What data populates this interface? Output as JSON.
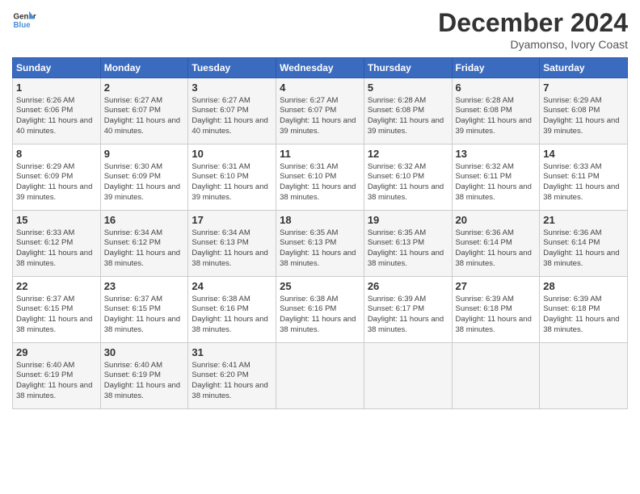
{
  "header": {
    "logo_line1": "General",
    "logo_line2": "Blue",
    "month": "December 2024",
    "location": "Dyamonso, Ivory Coast"
  },
  "weekdays": [
    "Sunday",
    "Monday",
    "Tuesday",
    "Wednesday",
    "Thursday",
    "Friday",
    "Saturday"
  ],
  "weeks": [
    [
      {
        "day": 1,
        "sunrise": "6:26 AM",
        "sunset": "6:06 PM",
        "daylight": "11 hours and 40 minutes."
      },
      {
        "day": 2,
        "sunrise": "6:27 AM",
        "sunset": "6:07 PM",
        "daylight": "11 hours and 40 minutes."
      },
      {
        "day": 3,
        "sunrise": "6:27 AM",
        "sunset": "6:07 PM",
        "daylight": "11 hours and 40 minutes."
      },
      {
        "day": 4,
        "sunrise": "6:27 AM",
        "sunset": "6:07 PM",
        "daylight": "11 hours and 39 minutes."
      },
      {
        "day": 5,
        "sunrise": "6:28 AM",
        "sunset": "6:08 PM",
        "daylight": "11 hours and 39 minutes."
      },
      {
        "day": 6,
        "sunrise": "6:28 AM",
        "sunset": "6:08 PM",
        "daylight": "11 hours and 39 minutes."
      },
      {
        "day": 7,
        "sunrise": "6:29 AM",
        "sunset": "6:08 PM",
        "daylight": "11 hours and 39 minutes."
      }
    ],
    [
      {
        "day": 8,
        "sunrise": "6:29 AM",
        "sunset": "6:09 PM",
        "daylight": "11 hours and 39 minutes."
      },
      {
        "day": 9,
        "sunrise": "6:30 AM",
        "sunset": "6:09 PM",
        "daylight": "11 hours and 39 minutes."
      },
      {
        "day": 10,
        "sunrise": "6:31 AM",
        "sunset": "6:10 PM",
        "daylight": "11 hours and 39 minutes."
      },
      {
        "day": 11,
        "sunrise": "6:31 AM",
        "sunset": "6:10 PM",
        "daylight": "11 hours and 38 minutes."
      },
      {
        "day": 12,
        "sunrise": "6:32 AM",
        "sunset": "6:10 PM",
        "daylight": "11 hours and 38 minutes."
      },
      {
        "day": 13,
        "sunrise": "6:32 AM",
        "sunset": "6:11 PM",
        "daylight": "11 hours and 38 minutes."
      },
      {
        "day": 14,
        "sunrise": "6:33 AM",
        "sunset": "6:11 PM",
        "daylight": "11 hours and 38 minutes."
      }
    ],
    [
      {
        "day": 15,
        "sunrise": "6:33 AM",
        "sunset": "6:12 PM",
        "daylight": "11 hours and 38 minutes."
      },
      {
        "day": 16,
        "sunrise": "6:34 AM",
        "sunset": "6:12 PM",
        "daylight": "11 hours and 38 minutes."
      },
      {
        "day": 17,
        "sunrise": "6:34 AM",
        "sunset": "6:13 PM",
        "daylight": "11 hours and 38 minutes."
      },
      {
        "day": 18,
        "sunrise": "6:35 AM",
        "sunset": "6:13 PM",
        "daylight": "11 hours and 38 minutes."
      },
      {
        "day": 19,
        "sunrise": "6:35 AM",
        "sunset": "6:13 PM",
        "daylight": "11 hours and 38 minutes."
      },
      {
        "day": 20,
        "sunrise": "6:36 AM",
        "sunset": "6:14 PM",
        "daylight": "11 hours and 38 minutes."
      },
      {
        "day": 21,
        "sunrise": "6:36 AM",
        "sunset": "6:14 PM",
        "daylight": "11 hours and 38 minutes."
      }
    ],
    [
      {
        "day": 22,
        "sunrise": "6:37 AM",
        "sunset": "6:15 PM",
        "daylight": "11 hours and 38 minutes."
      },
      {
        "day": 23,
        "sunrise": "6:37 AM",
        "sunset": "6:15 PM",
        "daylight": "11 hours and 38 minutes."
      },
      {
        "day": 24,
        "sunrise": "6:38 AM",
        "sunset": "6:16 PM",
        "daylight": "11 hours and 38 minutes."
      },
      {
        "day": 25,
        "sunrise": "6:38 AM",
        "sunset": "6:16 PM",
        "daylight": "11 hours and 38 minutes."
      },
      {
        "day": 26,
        "sunrise": "6:39 AM",
        "sunset": "6:17 PM",
        "daylight": "11 hours and 38 minutes."
      },
      {
        "day": 27,
        "sunrise": "6:39 AM",
        "sunset": "6:18 PM",
        "daylight": "11 hours and 38 minutes."
      },
      {
        "day": 28,
        "sunrise": "6:39 AM",
        "sunset": "6:18 PM",
        "daylight": "11 hours and 38 minutes."
      }
    ],
    [
      {
        "day": 29,
        "sunrise": "6:40 AM",
        "sunset": "6:19 PM",
        "daylight": "11 hours and 38 minutes."
      },
      {
        "day": 30,
        "sunrise": "6:40 AM",
        "sunset": "6:19 PM",
        "daylight": "11 hours and 38 minutes."
      },
      {
        "day": 31,
        "sunrise": "6:41 AM",
        "sunset": "6:20 PM",
        "daylight": "11 hours and 38 minutes."
      },
      null,
      null,
      null,
      null
    ]
  ]
}
